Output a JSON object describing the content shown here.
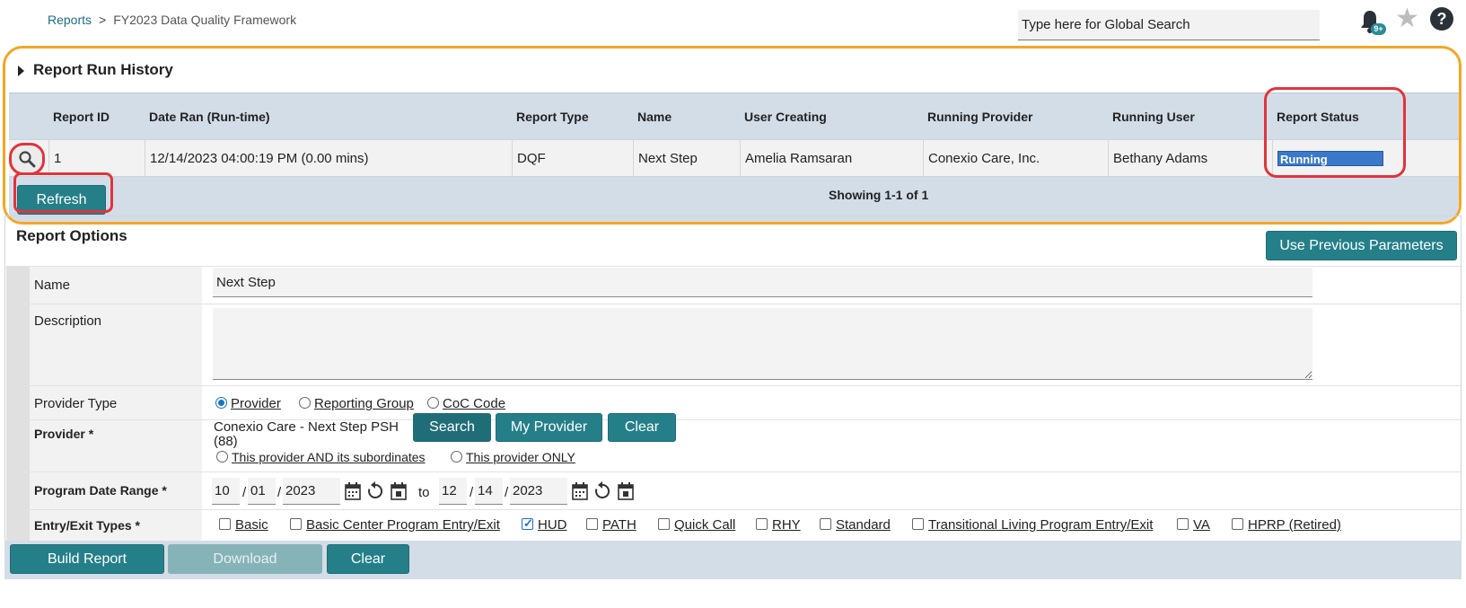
{
  "breadcrumb": {
    "root": "Reports",
    "separator": ">",
    "current": "FY2023 Data Quality Framework"
  },
  "global_search": {
    "placeholder": "Type here for Global Search"
  },
  "notifications": {
    "badge": "9+"
  },
  "history": {
    "title": "Report Run History",
    "columns": [
      "Report ID",
      "Date Ran (Run-time)",
      "Report Type",
      "Name",
      "User Creating",
      "Running Provider",
      "Running User",
      "Report Status"
    ],
    "rows": [
      {
        "report_id": "1",
        "date_ran": "12/14/2023 04:00:19 PM (0.00 mins)",
        "report_type": "DQF",
        "name": "Next Step",
        "user_creating": "Amelia Ramsaran",
        "running_provider": "Conexio Care, Inc.",
        "running_user": "Bethany Adams",
        "status": "Running"
      }
    ],
    "refresh_label": "Refresh",
    "showing": "Showing 1-1 of 1"
  },
  "options": {
    "title": "Report Options",
    "use_previous_label": "Use Previous Parameters",
    "name_label": "Name",
    "name_value": "Next Step",
    "description_label": "Description",
    "provider_type_label": "Provider Type",
    "provider_type_options": [
      "Provider",
      "Reporting Group",
      "CoC Code"
    ],
    "provider_type_selected": "Provider",
    "provider_label": "Provider *",
    "provider_value_line1": "Conexio Care - Next Step PSH",
    "provider_value_line2": "(88)",
    "provider_search": "Search",
    "provider_my": "My Provider",
    "provider_clear": "Clear",
    "provider_scope_options": [
      "This provider AND its subordinates",
      "This provider ONLY"
    ],
    "date_range_label": "Program Date Range *",
    "date_from": {
      "month": "10",
      "day": "01",
      "year": "2023"
    },
    "date_to_word": "to",
    "date_to": {
      "month": "12",
      "day": "14",
      "year": "2023"
    },
    "entry_exit_label": "Entry/Exit Types *",
    "entry_exit_types": [
      "Basic",
      "Basic Center Program Entry/Exit",
      "HUD",
      "PATH",
      "Quick Call",
      "RHY",
      "Standard",
      "Transitional Living Program Entry/Exit",
      "VA",
      "HPRP (Retired)"
    ],
    "entry_exit_checked": [
      "HUD"
    ]
  },
  "footer": {
    "build_label": "Build Report",
    "download_label": "Download",
    "clear_label": "Clear"
  },
  "colors": {
    "teal": "#257f89",
    "orange_highlight": "#f5a623",
    "red_highlight": "#e1343c",
    "running_fill": "#3a78c9"
  }
}
